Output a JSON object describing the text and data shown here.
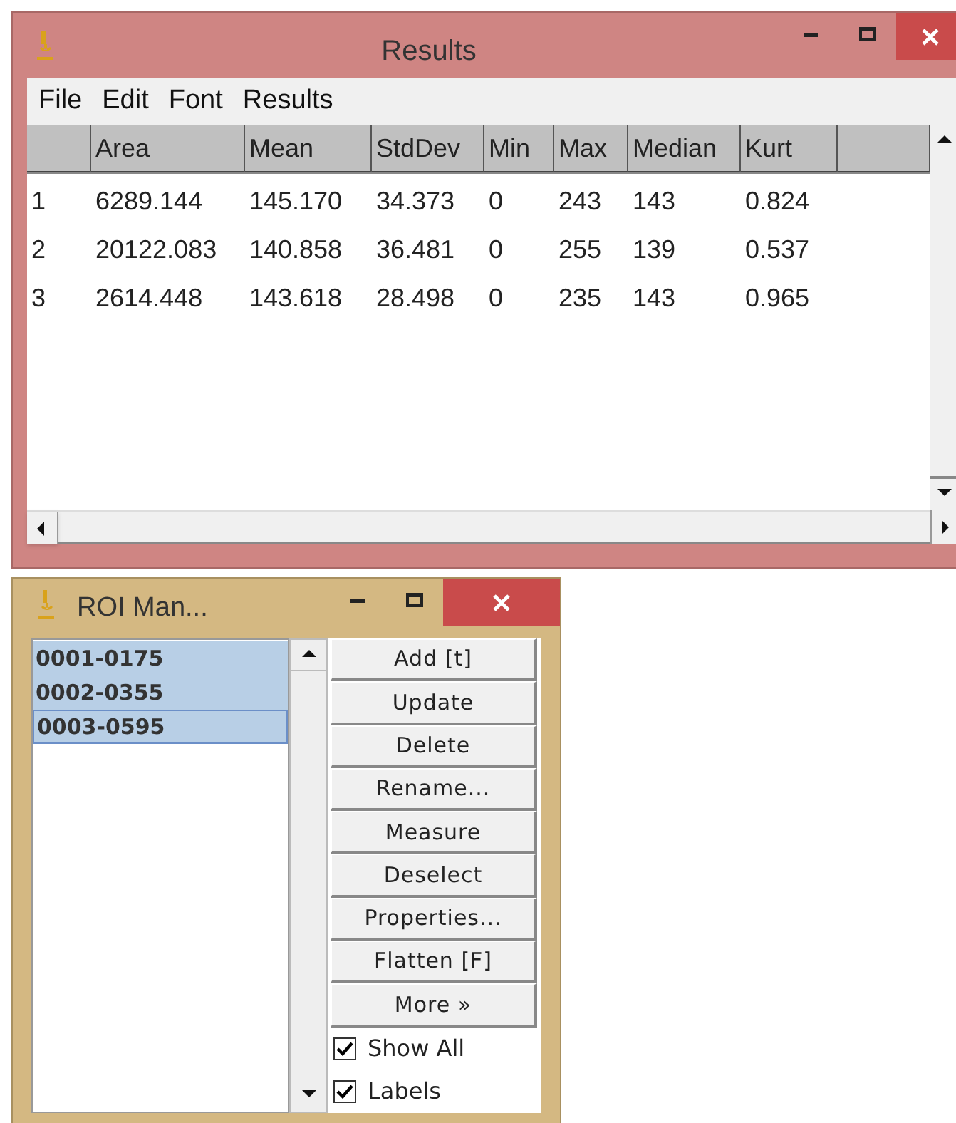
{
  "results_window": {
    "title": "Results",
    "menu": [
      "File",
      "Edit",
      "Font",
      "Results"
    ],
    "table": {
      "columns": [
        "",
        "Area",
        "Mean",
        "StdDev",
        "Min",
        "Max",
        "Median",
        "Kurt",
        ""
      ],
      "rows": [
        [
          "1",
          "6289.144",
          "145.170",
          "34.373",
          "0",
          "243",
          "143",
          "0.824"
        ],
        [
          "2",
          "20122.083",
          "140.858",
          "36.481",
          "0",
          "255",
          "139",
          "0.537"
        ],
        [
          "3",
          "2614.448",
          "143.618",
          "28.498",
          "0",
          "235",
          "143",
          "0.965"
        ]
      ]
    }
  },
  "roi_manager": {
    "title": "ROI Man...",
    "items": [
      {
        "label": "0001-0175",
        "selected": true
      },
      {
        "label": "0002-0355",
        "selected": true
      },
      {
        "label": "0003-0595",
        "selected": true
      }
    ],
    "buttons": [
      "Add [t]",
      "Update",
      "Delete",
      "Rename...",
      "Measure",
      "Deselect",
      "Properties...",
      "Flatten [F]",
      "More »"
    ],
    "checkboxes": [
      {
        "label": "Show All",
        "checked": true
      },
      {
        "label": "Labels",
        "checked": true
      }
    ]
  }
}
